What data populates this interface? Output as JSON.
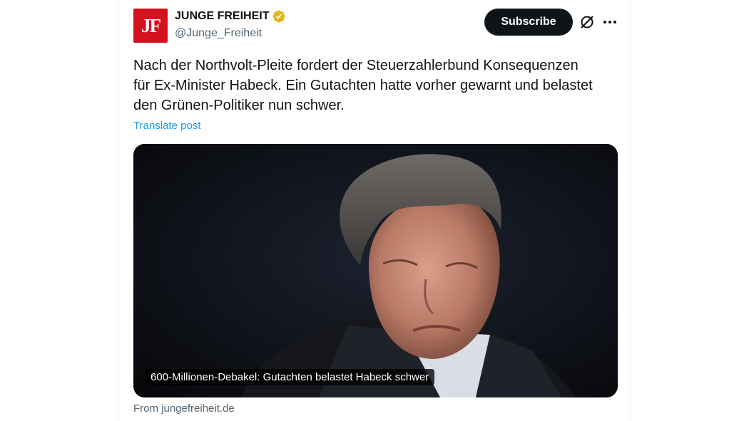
{
  "account": {
    "avatar_text": "JF",
    "display_name": "JUNGE FREIHEIT",
    "handle": "@Junge_Freiheit",
    "verified_icon": "verified-badge-gold",
    "verified_color": "#e2b719"
  },
  "actions": {
    "subscribe_label": "Subscribe",
    "grok_icon": "grok-icon",
    "more_icon": "more-horizontal-icon"
  },
  "post": {
    "lines": [
      "Nach der Northvolt-Pleite fordert der Steuerzahlerbund Konsequenzen",
      "für Ex-Minister Habeck. Ein Gutachten hatte vorher gewarnt und belastet",
      "den Grünen-Politiker nun schwer."
    ],
    "translate_label": "Translate post"
  },
  "card": {
    "caption": "600-Millionen-Debakel: Gutachten belastet Habeck schwer",
    "source": "From jungefreiheit.de"
  },
  "colors": {
    "brand_red": "#d4121f",
    "link_blue": "#1d9bf0",
    "text_primary": "#0f1419",
    "text_secondary": "#536471"
  }
}
